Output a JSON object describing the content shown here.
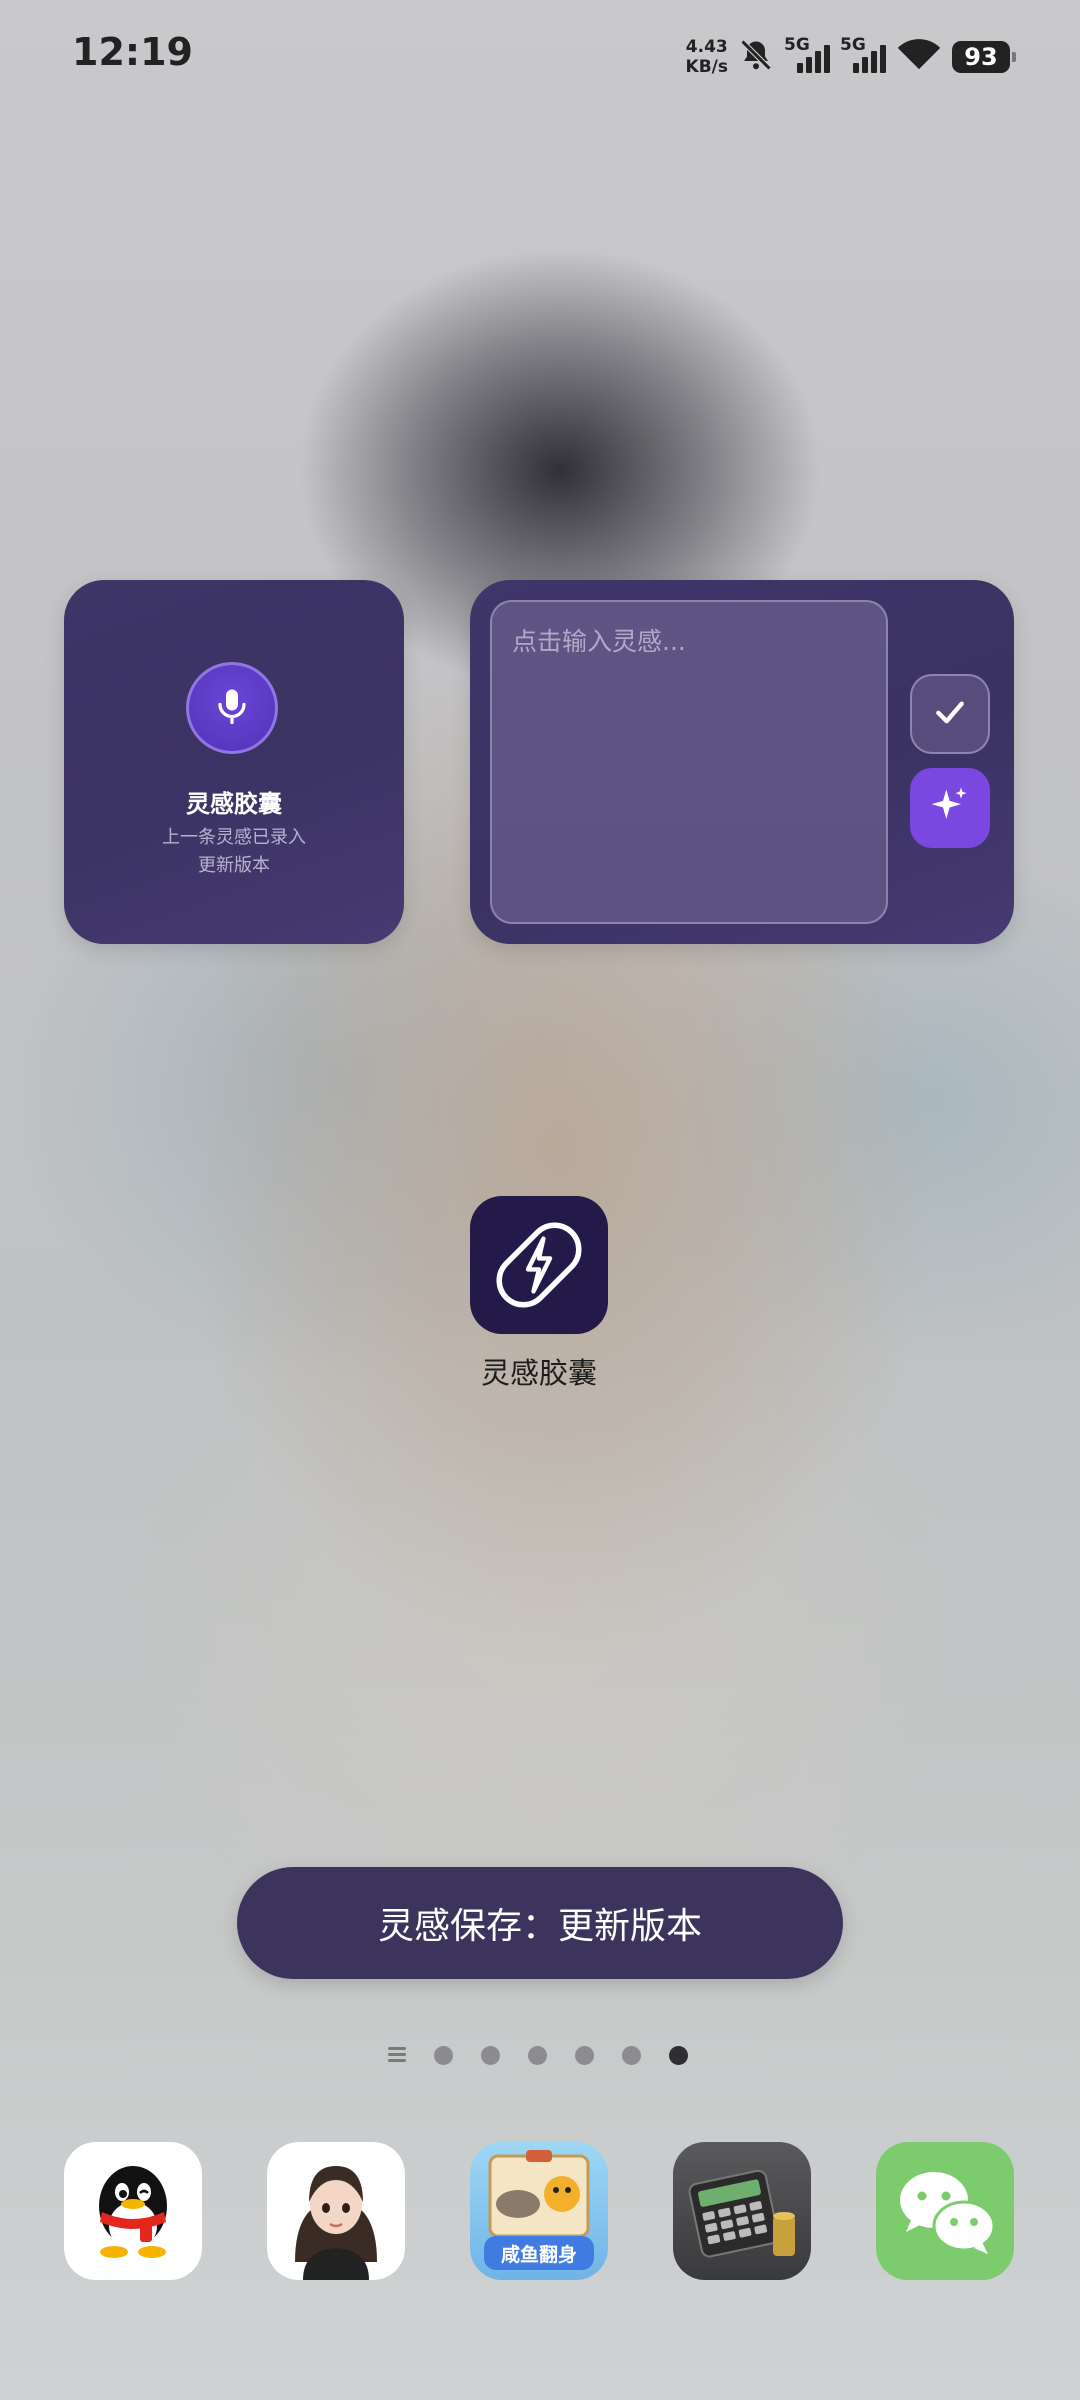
{
  "status_bar": {
    "time": "12:19",
    "net_speed_value": "4.43",
    "net_speed_unit": "KB/s",
    "signal1_label": "5G",
    "signal2_label": "5G",
    "battery": "93"
  },
  "widget_small": {
    "title": "灵感胶囊",
    "line1": "上一条灵感已录入",
    "line2": "更新版本"
  },
  "widget_wide": {
    "placeholder": "点击输入灵感..."
  },
  "app": {
    "label": "灵感胶囊"
  },
  "toast": {
    "text": "灵感保存：更新版本"
  },
  "page_indicator": {
    "pages": 6,
    "active_index": 5
  },
  "dock": {
    "icons": [
      "qq-icon",
      "avatar-app-icon",
      "game-app-icon",
      "calculator-icon",
      "wechat-icon"
    ],
    "game_icon_caption": "咸鱼翻身"
  }
}
